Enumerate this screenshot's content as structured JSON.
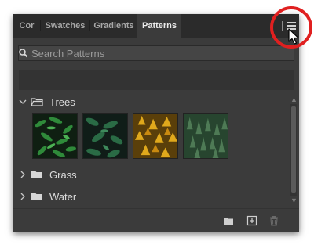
{
  "tabs": [
    {
      "label": "Cor"
    },
    {
      "label": "Swatches"
    },
    {
      "label": "Gradients"
    },
    {
      "label": "Patterns"
    }
  ],
  "search": {
    "placeholder": "Search Patterns"
  },
  "groups": [
    {
      "label": "Trees",
      "expanded": true
    },
    {
      "label": "Grass",
      "expanded": false
    },
    {
      "label": "Water",
      "expanded": false
    }
  ],
  "patterns": [
    {
      "name": "dark-green-leaves"
    },
    {
      "name": "dark-foliage"
    },
    {
      "name": "yellow-autumn-trees"
    },
    {
      "name": "pine-forest"
    }
  ],
  "colors": {
    "panel_bg": "#3b3b3b",
    "tabbar_bg": "#2b2b2b",
    "highlight": "#e02020"
  },
  "icons": {
    "tab_overflow": "chevron-right-icon",
    "panel_menu": "hamburger-menu-icon",
    "search": "search-icon",
    "new_group": "folder-icon",
    "new_pattern": "plus-square-icon",
    "delete": "trash-icon"
  }
}
